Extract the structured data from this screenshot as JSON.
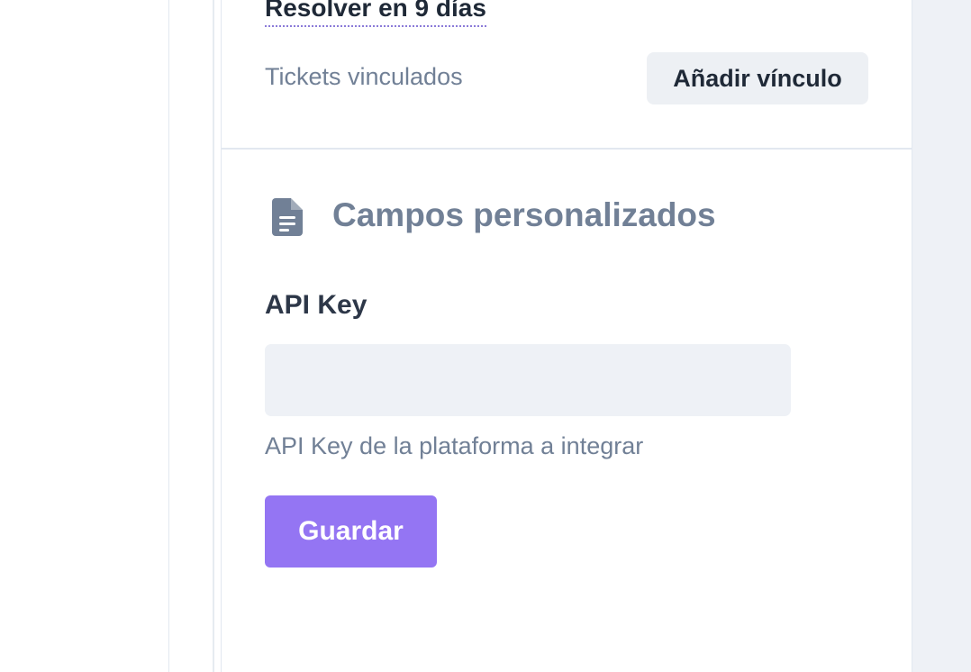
{
  "ticket": {
    "sla_text": "Resolver en 9 días",
    "linked_tickets_label": "Tickets vinculados",
    "add_link_label": "Añadir vínculo"
  },
  "custom_fields": {
    "title": "Campos personalizados",
    "icon": "document-icon",
    "api_key": {
      "label": "API Key",
      "value": "",
      "placeholder": "",
      "help": "API Key de la plataforma a integrar"
    },
    "save_label": "Guardar"
  },
  "colors": {
    "accent": "#9475f3",
    "muted_text": "#718096",
    "dark_text": "#1f2937",
    "input_bg": "#eef1f6"
  }
}
